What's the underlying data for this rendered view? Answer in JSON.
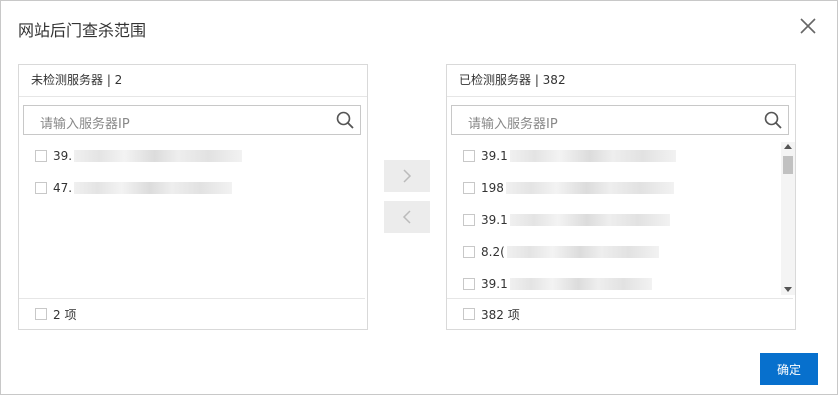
{
  "dialog": {
    "title": "网站后门查杀范围",
    "close_icon": "close-icon"
  },
  "left_panel": {
    "header": "未检测服务器 | 2",
    "search_placeholder": "请输入服务器IP",
    "items": [
      {
        "prefix": "39."
      },
      {
        "prefix": "47."
      }
    ],
    "footer": "2 项"
  },
  "right_panel": {
    "header": "已检测服务器 | 382",
    "search_placeholder": "请输入服务器IP",
    "items": [
      {
        "prefix": "39.1"
      },
      {
        "prefix": "198"
      },
      {
        "prefix": "39.1"
      },
      {
        "prefix": "8.2("
      },
      {
        "prefix": "39.1"
      }
    ],
    "footer": "382 项"
  },
  "transfer": {
    "to_right_icon": "chevron-right-icon",
    "to_left_icon": "chevron-left-icon"
  },
  "actions": {
    "confirm": "确定"
  },
  "colors": {
    "primary": "#0770cd",
    "border": "#d9d9d9",
    "button_bg": "#ececec"
  }
}
